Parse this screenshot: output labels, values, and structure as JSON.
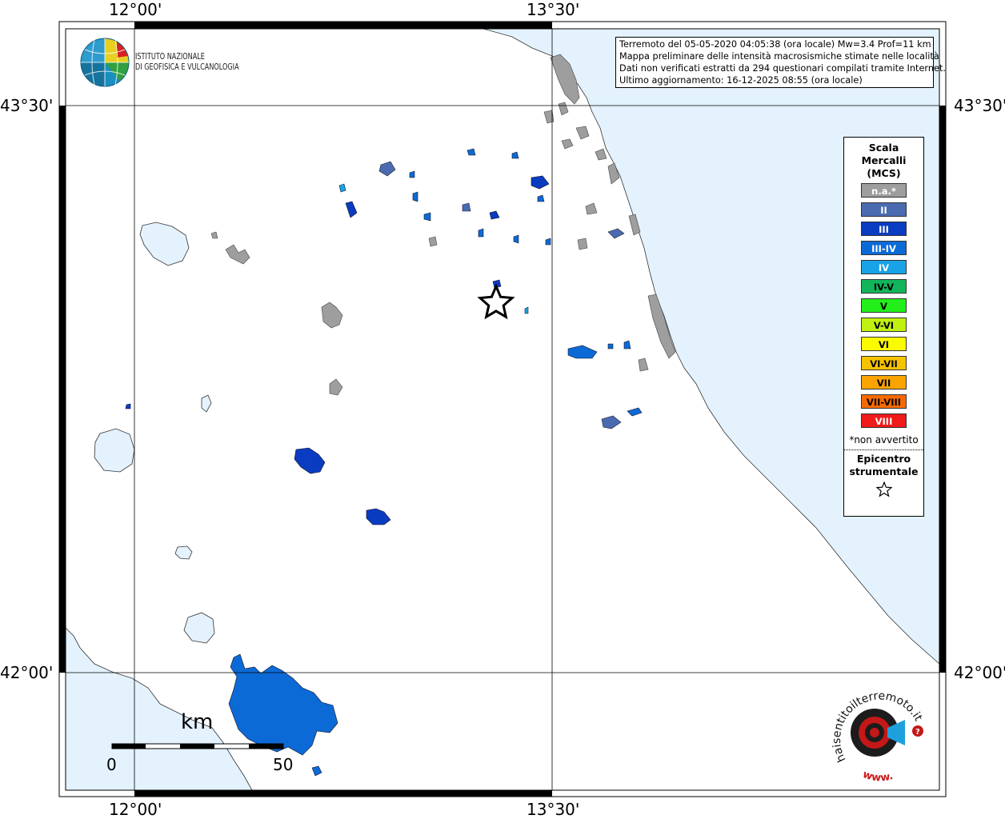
{
  "info": {
    "line1": "Terremoto del 05-05-2020 04:05:38 (ora locale) Mw=3.4 Prof=11 km",
    "line2": "Mappa preliminare delle intensità macrosismiche stimate nelle località",
    "line3": "Dati non verificati estratti da 294 questionari compilati tramite Internet.",
    "line4": "Ultimo aggiornamento: 16-12-2025 08:55 (ora locale)"
  },
  "logo": {
    "line1": "ISTITUTO NAZIONALE",
    "line2": "DI GEOFISICA E VULCANOLOGIA"
  },
  "coords": {
    "top_left": "12°00'",
    "top_right": "13°30'",
    "bottom_left": "12°00'",
    "bottom_right": "13°30'",
    "left_top": "43°30'",
    "left_bottom": "42°00'",
    "right_top": "43°30'",
    "right_bottom": "42°00'"
  },
  "legend": {
    "title_1": "Scala",
    "title_2": "Mercalli",
    "title_3": "(MCS)",
    "items": [
      {
        "label": "n.a.*",
        "color": "#9e9e9e",
        "text_color": "#ffffff"
      },
      {
        "label": "II",
        "color": "#4a6bb0",
        "text_color": "#ffffff"
      },
      {
        "label": "III",
        "color": "#0a3cc2",
        "text_color": "#ffffff"
      },
      {
        "label": "III-IV",
        "color": "#0c6ad6",
        "text_color": "#ffffff"
      },
      {
        "label": "IV",
        "color": "#18a3e6",
        "text_color": "#ffffff"
      },
      {
        "label": "IV-V",
        "color": "#13b55a",
        "text_color": "#000000"
      },
      {
        "label": "V",
        "color": "#22ee1a",
        "text_color": "#000000"
      },
      {
        "label": "V-VI",
        "color": "#c0f010",
        "text_color": "#000000"
      },
      {
        "label": "VI",
        "color": "#fafa00",
        "text_color": "#000000"
      },
      {
        "label": "VI-VII",
        "color": "#f5c300",
        "text_color": "#000000"
      },
      {
        "label": "VII",
        "color": "#fba400",
        "text_color": "#000000"
      },
      {
        "label": "VII-VIII",
        "color": "#f56a00",
        "text_color": "#000000"
      },
      {
        "label": "VIII",
        "color": "#ef1a1a",
        "text_color": "#ffffff"
      }
    ],
    "note": "*non avvertito",
    "epicenter_1": "Epicentro",
    "epicenter_2": "strumentale"
  },
  "scale_bar": {
    "unit": "km",
    "min": "0",
    "max": "50"
  },
  "haisentito": {
    "text": "haisentitoilterremoto.it",
    "www": "www."
  },
  "colors": {
    "sea": "#e3f2fc",
    "lake": "#e3f2fc",
    "frame": "#000000"
  },
  "epicenter_icon": "star-icon"
}
